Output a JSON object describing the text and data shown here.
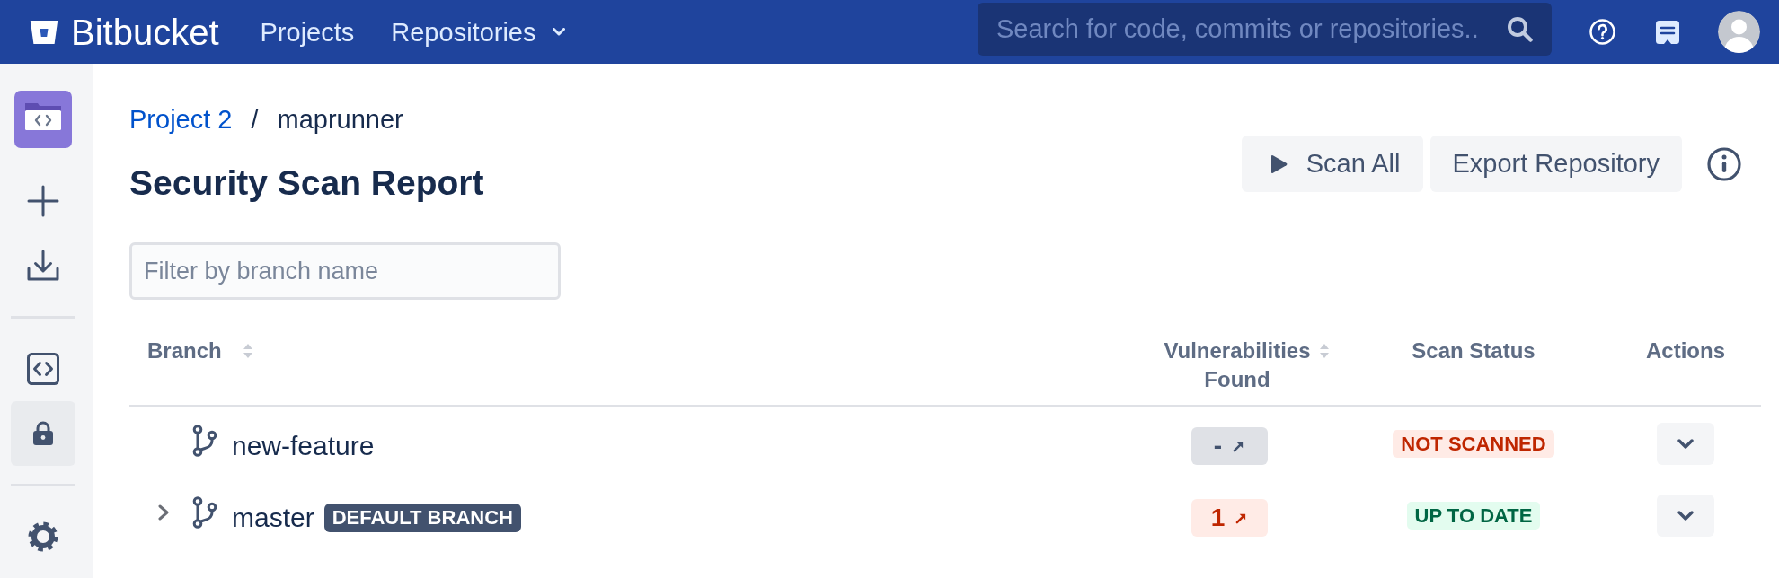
{
  "topbar": {
    "brand": "Bitbucket",
    "nav": [
      {
        "label": "Projects",
        "dropdown": false
      },
      {
        "label": "Repositories",
        "dropdown": true
      }
    ],
    "search": {
      "placeholder": "Search for code, commits or repositories.."
    }
  },
  "sidebar": {
    "groups": [
      {
        "items": [
          {
            "selected": false
          },
          {
            "selected": false
          },
          {
            "selected": false
          }
        ]
      },
      {
        "items": [
          {
            "selected": false
          },
          {
            "selected": true
          }
        ]
      },
      {
        "items": [
          {
            "selected": false
          }
        ]
      }
    ]
  },
  "breadcrumb": {
    "items": [
      "Project 2",
      "maprunner"
    ],
    "separator": "/"
  },
  "header": {
    "title": "Security Scan Report",
    "buttons": [
      {
        "label": "Scan All",
        "kind": "play"
      },
      {
        "label": "Export Repository",
        "kind": "text"
      }
    ]
  },
  "filter": {
    "placeholder": "Filter by branch name"
  },
  "table": {
    "columns": [
      {
        "label": "Branch",
        "sortable": true
      },
      {
        "label": "Vulnerabilities Found",
        "sortable": true
      },
      {
        "label": "Scan Status",
        "sortable": false
      },
      {
        "label": "Actions",
        "sortable": false
      }
    ],
    "rows": [
      {
        "branch": "new-feature",
        "vulnerabilities": {
          "count": "-",
          "kind": "none"
        },
        "status": {
          "label": "NOT SCANNED",
          "kind": "not-scanned"
        }
      },
      {
        "branch": "master",
        "expanded": false,
        "badge": "DEFAULT BRANCH",
        "vulnerabilities": {
          "count": "1",
          "kind": "found"
        },
        "status": {
          "label": "UP TO DATE",
          "kind": "up-to-date"
        }
      }
    ]
  }
}
